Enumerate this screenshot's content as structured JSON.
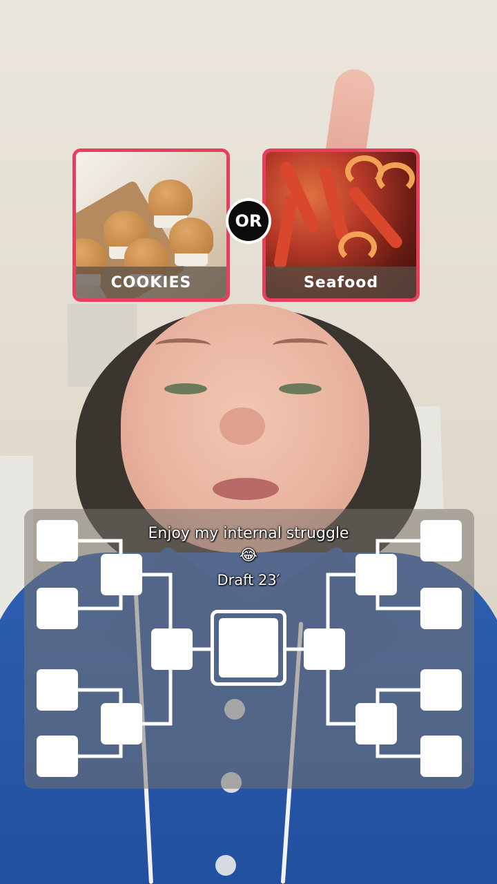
{
  "choice_cards": {
    "left": {
      "label": "COOKIES"
    },
    "right": {
      "label": "Seafood"
    },
    "separator": "OR"
  },
  "caption": {
    "line1": "Enjoy my internal struggle",
    "line2": "😂",
    "line3": "Draft 23′"
  },
  "bracket": {
    "first_round_slots_per_side": 4,
    "second_round_slots_per_side": 2,
    "semifinal_slots_per_side": 1,
    "final_slots": 1
  },
  "colors": {
    "card_border": "#e63e5c",
    "or_badge": "#0c0c0c",
    "bracket_panel": "#78736e",
    "slot": "#ffffff"
  }
}
